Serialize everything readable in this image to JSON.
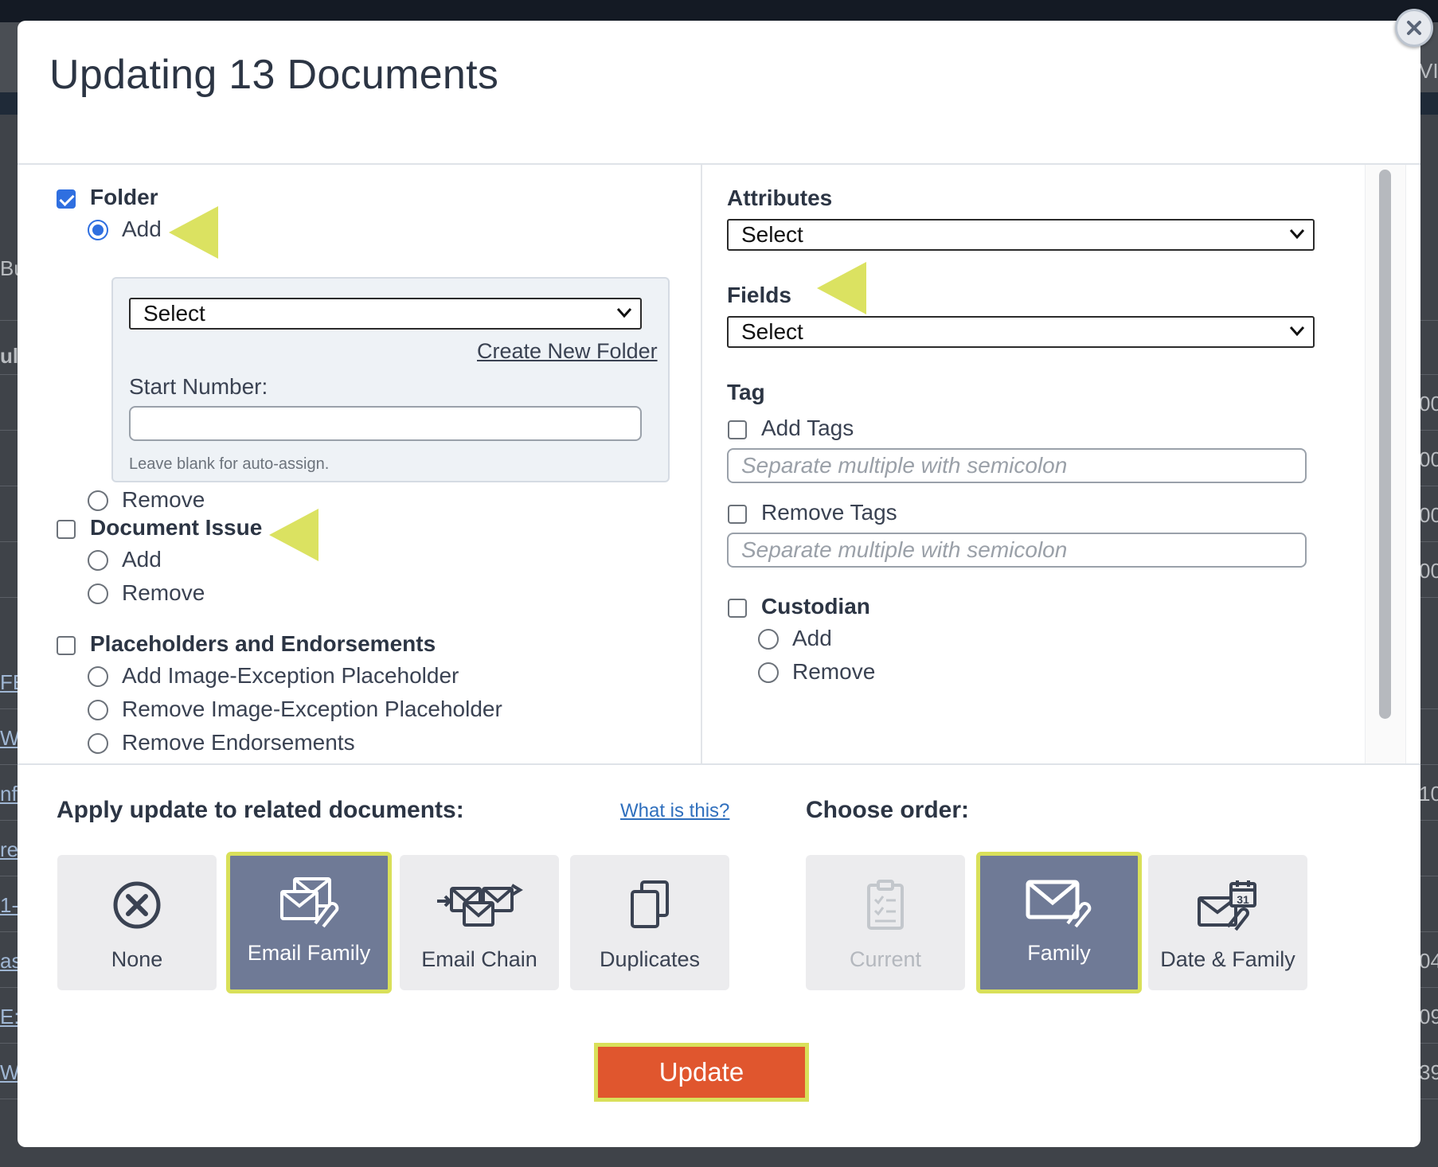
{
  "background": {
    "cells": [
      "Bu",
      "ul",
      "00",
      "00",
      "00",
      "00",
      "FE",
      "W",
      "nfo",
      "re",
      "1-",
      "as",
      "E:",
      "W",
      "10",
      "04",
      "09",
      "39",
      "VI"
    ]
  },
  "modal": {
    "title": "Updating 13 Documents",
    "close_icon": "close-icon",
    "left": {
      "folder": {
        "label": "Folder",
        "checked": true,
        "add_label": "Add",
        "add_selected": true,
        "select_value": "Select",
        "create_new_label": "Create New Folder",
        "start_number_label": "Start Number:",
        "start_number_value": "",
        "hint": "Leave blank for auto-assign.",
        "remove_label": "Remove"
      },
      "document_issue": {
        "label": "Document Issue",
        "checked": false,
        "add_label": "Add",
        "remove_label": "Remove"
      },
      "placeholders": {
        "label": "Placeholders and Endorsements",
        "checked": false,
        "options": [
          "Add Image-Exception Placeholder",
          "Remove Image-Exception Placeholder",
          "Remove Endorsements"
        ]
      }
    },
    "right": {
      "attributes": {
        "label": "Attributes",
        "select_value": "Select"
      },
      "fields": {
        "label": "Fields",
        "select_value": "Select"
      },
      "tag": {
        "label": "Tag",
        "add_tags_label": "Add Tags",
        "add_placeholder": "Separate multiple with semicolon",
        "remove_tags_label": "Remove Tags",
        "remove_placeholder": "Separate multiple with semicolon"
      },
      "custodian": {
        "label": "Custodian",
        "add_label": "Add",
        "remove_label": "Remove"
      }
    },
    "footer": {
      "apply_label": "Apply update to related documents:",
      "what_is_this": "What is this?",
      "apply_options": [
        {
          "label": "None",
          "icon": "none-circle-x-icon"
        },
        {
          "label": "Email Family",
          "icon": "email-family-icon",
          "active": true
        },
        {
          "label": "Email Chain",
          "icon": "email-chain-icon"
        },
        {
          "label": "Duplicates",
          "icon": "duplicates-icon"
        }
      ],
      "order_label": "Choose order:",
      "order_options": [
        {
          "label": "Current",
          "icon": "clipboard-list-icon",
          "disabled": true
        },
        {
          "label": "Family",
          "icon": "family-email-icon",
          "active": true
        },
        {
          "label": "Date & Family",
          "icon": "date-family-icon"
        }
      ],
      "update_label": "Update"
    },
    "colors": {
      "accent_blue": "#2f6fe0",
      "tile_active": "#6f7a96",
      "highlight_yellow": "#d9e05a",
      "update_orange": "#e0562e"
    }
  }
}
